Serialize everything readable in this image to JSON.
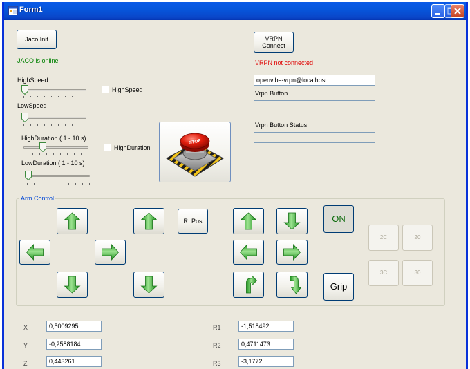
{
  "window": {
    "title": "Form1"
  },
  "top_left": {
    "jaco_init_label": "Jaco Init",
    "jaco_status": "JACO is online",
    "high_speed_label": "HighSpeed",
    "high_speed_check_label": "HighSpeed",
    "low_speed_label": "LowSpeed",
    "high_duration_label": "HighDuration ( 1 - 10 s)",
    "high_duration_check_label": "HighDuration",
    "low_duration_label": "LowDuration ( 1 - 10 s)"
  },
  "sliders": {
    "high_speed": 0.1,
    "low_speed": 0.0,
    "high_duration": 0.3,
    "low_duration": 0.0
  },
  "vrpn": {
    "connect_label": "VRPN\nConnect",
    "status": "VRPN not connected",
    "address_value": "openvibe-vrpn@localhost",
    "button_label": "Vrpn Button",
    "button_value": "",
    "button_status_label": "Vrpn Button Status",
    "button_status_value": ""
  },
  "stop_button": {
    "icon": "emergency-stop-icon",
    "text": "STOP"
  },
  "arm_control": {
    "group_label": "Arm Control",
    "rpos_label": "R. Pos",
    "on_label": "ON",
    "grip_label": "Grip",
    "finger_buttons": [
      "2C",
      "20",
      "3C",
      "30"
    ]
  },
  "coords": {
    "x_label": "X",
    "x_value": "0,5009295",
    "y_label": "Y",
    "y_value": "-0,2588184",
    "z_label": "Z",
    "z_value": "0,443261",
    "r1_label": "R1",
    "r1_value": "-1,518492",
    "r2_label": "R2",
    "r2_value": "0,4711473",
    "r3_label": "R3",
    "r3_value": "-3,1772"
  },
  "colors": {
    "titlebar": "#0a5ae8",
    "online_text": "#008000",
    "error_text": "#e00000",
    "group_text": "#0046d5",
    "arrow_green": "#2fb12f"
  }
}
